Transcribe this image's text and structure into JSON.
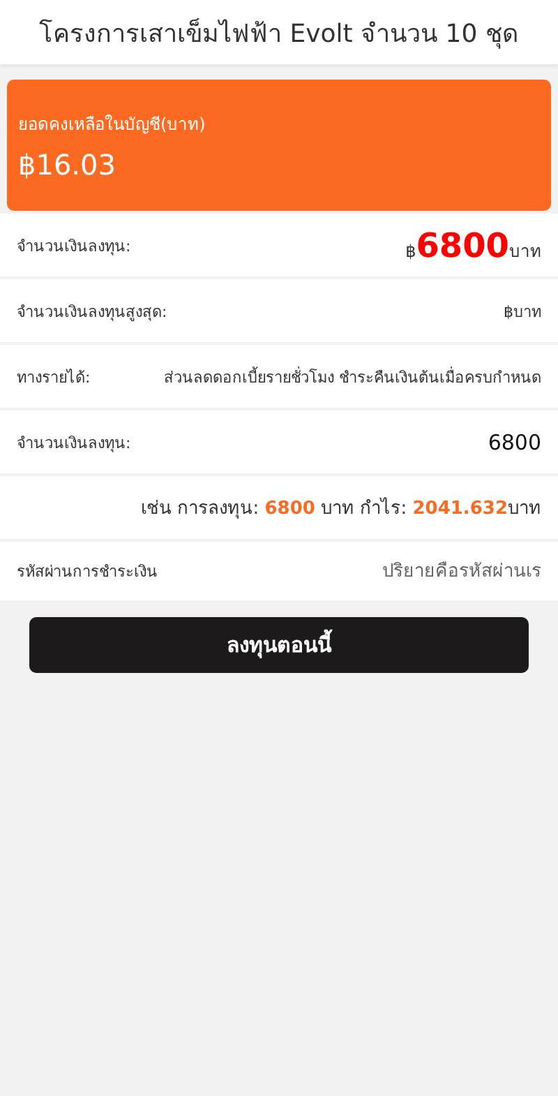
{
  "header": {
    "title": "โครงการเสาเข็มไฟฟ้า Evolt จำนวน 10 ชุด"
  },
  "balance": {
    "label": "ยอดคงเหลือในบัญชี(บาท)",
    "amount": "฿16.03"
  },
  "rows": [
    {
      "kind": "amount",
      "label": "จำนวนเงินลงทุน:",
      "currency": "฿",
      "value": "6800",
      "unit": "บาท"
    },
    {
      "kind": "text",
      "label": "จำนวนเงินลงทุนสูงสุด:",
      "value": "฿บาท"
    },
    {
      "kind": "text",
      "label": "ทางรายได้:",
      "value": "ส่วนลดดอกเบี้ยรายชั่วโมง ชำระคืนเงินต้นเมื่อครบกำหนด"
    },
    {
      "kind": "input",
      "label": "จำนวนเงินลงทุน:",
      "value": "6800"
    },
    {
      "kind": "example",
      "parts": [
        {
          "text": "เช่น การลงทุน: ",
          "highlight": false
        },
        {
          "text": "6800",
          "highlight": true
        },
        {
          "text": " บาท กำไร: ",
          "highlight": false
        },
        {
          "text": "2041.632",
          "highlight": true
        },
        {
          "text": "บาท",
          "highlight": false
        }
      ]
    },
    {
      "kind": "password",
      "label": "รหัสผ่านการชำระเงิน",
      "placeholder": "ปริยายคือรหัสผ่านเร"
    }
  ],
  "button": {
    "label": "ลงทุนตอนนี้"
  }
}
